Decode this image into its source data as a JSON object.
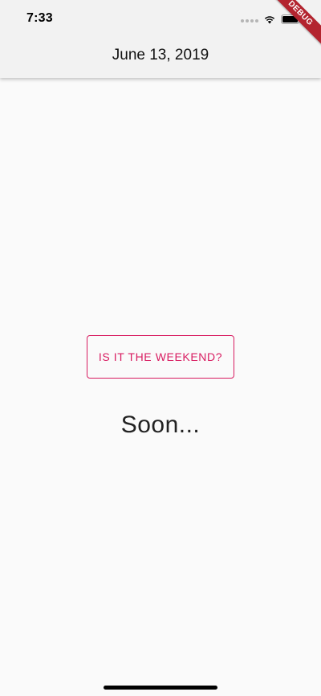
{
  "status_bar": {
    "time": "7:33"
  },
  "app_bar": {
    "title": "June 13, 2019"
  },
  "debug_banner": {
    "label": "DEBUG",
    "color": "#b3242f"
  },
  "main": {
    "button_label": "IS IT THE WEEKEND?",
    "result_text": "Soon..."
  },
  "colors": {
    "accent": "#d81b60",
    "background": "#fafafa",
    "appbar": "#f2f2f2"
  },
  "icons": {
    "signal": "signal-dots-icon",
    "wifi": "wifi-icon",
    "battery": "battery-icon"
  }
}
